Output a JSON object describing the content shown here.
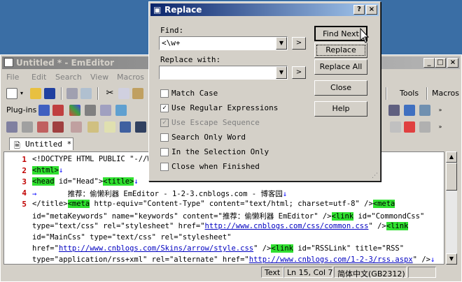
{
  "editor_window": {
    "title": "Untitled * - EmEditor",
    "menu": [
      "File",
      "Edit",
      "Search",
      "View",
      "Macros"
    ],
    "toolbar_labels": {
      "tools": "Tools",
      "macros": "Macros",
      "plugins": "Plug-ins"
    },
    "tab_label": "Untitled *",
    "line_numbers": [
      "1",
      "2",
      "3",
      "4",
      "5"
    ],
    "status": {
      "encoding_type": "Text",
      "position": "Ln 15, Col 7",
      "encoding": "简体中文(GB2312)"
    }
  },
  "code_lines": {
    "l1": "<!DOCTYPE HTML PUBLIC \"-//W3C",
    "l2_tag": "<html>",
    "l3_tag1": "<head",
    "l3_mid": " id=\"Head\">",
    "l3_tag2": "<title>",
    "l4": "推荐：偷懒利器 EmEditor - 1-2-3.cnblogs.com - 博客园",
    "l5_tag1": "</title>",
    "l5_tag2": "<meta",
    "l5_text": " http-equiv=\"Content-Type\" content=\"text/html; charset=utf-8\" />",
    "l5_tag3": "<meta",
    "w1": "id=\"metaKeywords\" name=\"keywords\" content=\"推荐：偷懒利器 EmEditor\" />",
    "w1_tag": "<link",
    "w1_end": " id=\"CommondCss\"",
    "w2_a": "type=\"text/css\" rel=\"stylesheet\" href=\"",
    "w2_link": "http://www.cnblogs.com/css/common.css",
    "w2_b": "\" />",
    "w2_tag": "<link",
    "w3": "id=\"MainCss\" type=\"text/css\" rel=\"stylesheet\"",
    "w4_a": "href=\"",
    "w4_link": "http://www.cnblogs.com/Skins/arrow/style.css",
    "w4_b": "\" />",
    "w4_tag": "<link",
    "w4_end": " id=\"RSSLink\" title=\"RSS\"",
    "w5_a": "type=\"application/rss+xml\" rel=\"alternate\" href=\"",
    "w5_link": "http://www.cnblogs.com/1-2-3/rss.aspx",
    "w5_b": "\" />"
  },
  "dialog": {
    "title": "Replace",
    "find_label": "Find:",
    "find_value": "<\\w+",
    "replace_label": "Replace with:",
    "replace_value": "",
    "buttons": {
      "find_next": "Find Next",
      "replace": "Replace",
      "replace_all": "Replace All",
      "close": "Close",
      "help": "Help"
    },
    "options": [
      {
        "label": "Match Case",
        "checked": false,
        "enabled": true
      },
      {
        "label": "Use Regular Expressions",
        "checked": true,
        "enabled": true
      },
      {
        "label": "Use Escape Sequence",
        "checked": true,
        "enabled": false
      },
      {
        "label": "Search Only Word",
        "checked": false,
        "enabled": true
      },
      {
        "label": "In the Selection Only",
        "checked": false,
        "enabled": true
      },
      {
        "label": "Close when Finished",
        "checked": false,
        "enabled": true
      }
    ]
  }
}
